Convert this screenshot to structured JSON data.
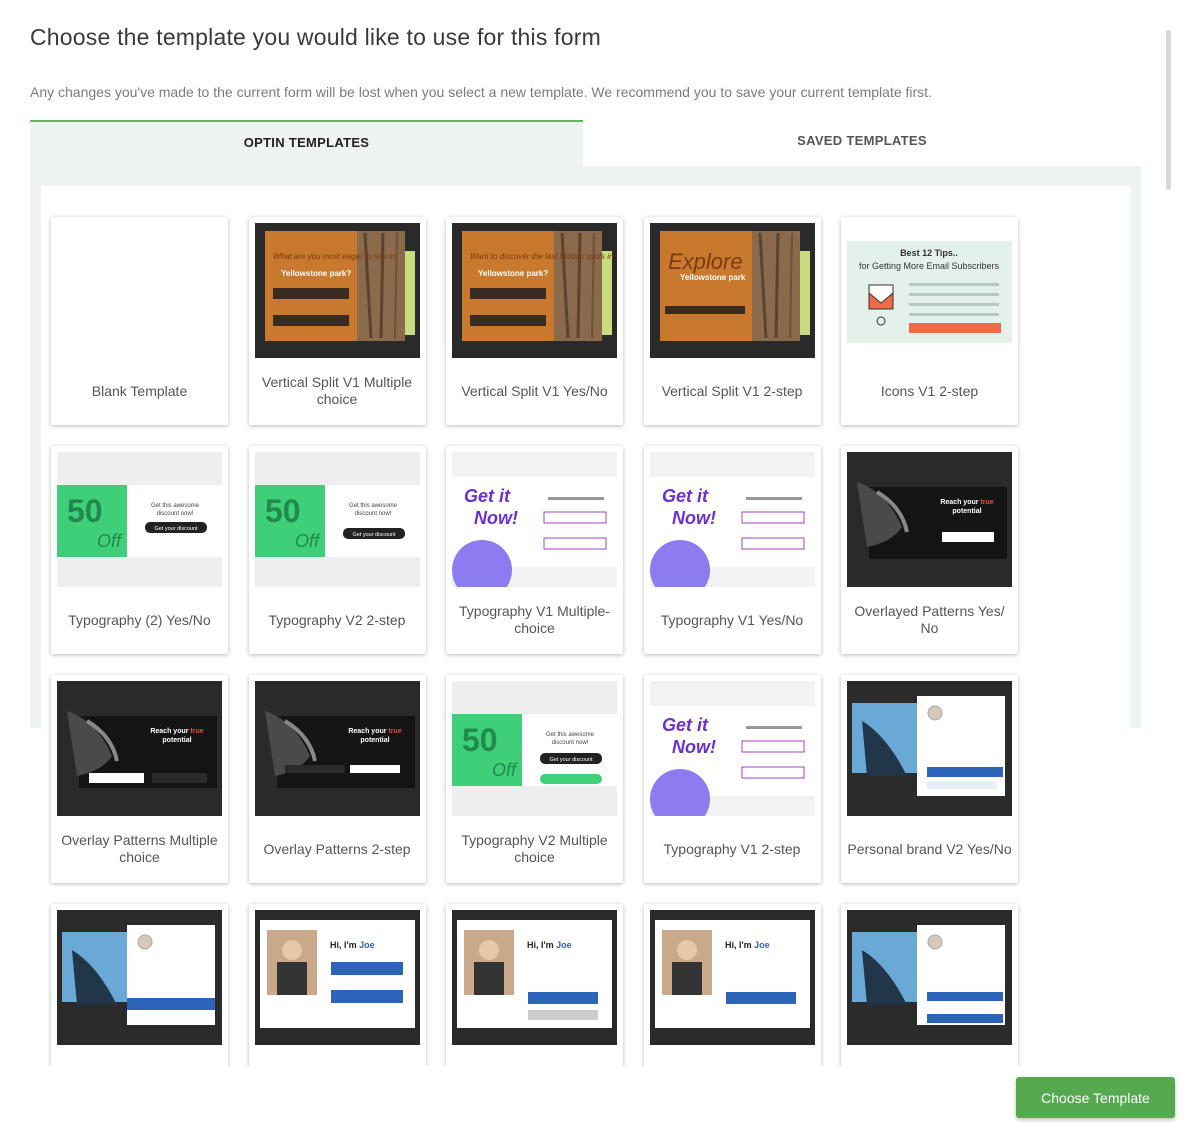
{
  "header": {
    "title": "Choose the template you would like to use for this form",
    "subtitle": "Any changes you've made to the current form will be lost when you select a new template. We recommend you to save your current template first."
  },
  "tabs": [
    {
      "label": "OPTIN TEMPLATES",
      "active": true
    },
    {
      "label": "SAVED TEMPLATES",
      "active": false
    }
  ],
  "thumb_text": {
    "yellowstone_q1": "What are you most eager to see in",
    "yellowstone_q2": "Want to discover the last hidden spots in",
    "explore": "Explore",
    "yellowstone_park": "Yellowstone park",
    "tips_title": "Best 12 Tips.. for Getting More Email Subscribers",
    "fifty": "50",
    "off": "Off",
    "get_discount": "Get your discount",
    "get_it_now": "Get it Now!",
    "reach_true_potential": "Reach your true potential",
    "hi_im_joe": "Hi, I'm Joe"
  },
  "templates": [
    {
      "name": "Blank Template",
      "thumb": "blank"
    },
    {
      "name": "Vertical Split V1 Multiple choice",
      "thumb": "yellowstone1"
    },
    {
      "name": "Vertical Split V1 Yes/No",
      "thumb": "yellowstone2"
    },
    {
      "name": "Vertical Split V1 2-step",
      "thumb": "yellowstone3"
    },
    {
      "name": "Icons V1 2-step",
      "thumb": "icons"
    },
    {
      "name": "Typography (2) Yes/No",
      "thumb": "typo50"
    },
    {
      "name": "Typography V2 2-step",
      "thumb": "typo50b"
    },
    {
      "name": "Typography V1 Multiple-choice",
      "thumb": "getit"
    },
    {
      "name": "Typography V1 Yes/No",
      "thumb": "getit"
    },
    {
      "name": "Overlayed Patterns Yes/ No",
      "thumb": "overlay"
    },
    {
      "name": "Overlay Patterns Multiple choice",
      "thumb": "overlay2"
    },
    {
      "name": "Overlay Patterns 2-step",
      "thumb": "overlay3"
    },
    {
      "name": "Typography V2 Multiple choice",
      "thumb": "typo50c"
    },
    {
      "name": "Typography V1 2-step",
      "thumb": "getit"
    },
    {
      "name": "Personal brand V2 Yes/No",
      "thumb": "personal"
    },
    {
      "name": "",
      "thumb": "personal2"
    },
    {
      "name": "",
      "thumb": "joe"
    },
    {
      "name": "",
      "thumb": "joe2"
    },
    {
      "name": "",
      "thumb": "joe3"
    },
    {
      "name": "",
      "thumb": "personal3"
    }
  ],
  "footer": {
    "choose_button": "Choose Template"
  },
  "colors": {
    "accent": "#5db85c",
    "button": "#55a94f",
    "panel": "#eef2f1"
  }
}
